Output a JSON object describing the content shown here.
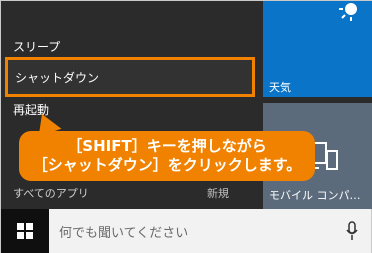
{
  "power_menu": {
    "sleep": "スリープ",
    "shutdown": "シャットダウン",
    "restart": "再起動"
  },
  "start_menu": {
    "all_apps": "すべてのアプリ",
    "new_label": "新規"
  },
  "tiles": {
    "weather": "天気",
    "pc": "モバイル コンパ…"
  },
  "callout": {
    "line1": "［SHIFT］キーを押しながら",
    "line2": "［シャットダウン］をクリックします。"
  },
  "taskbar": {
    "search_placeholder": "何でも聞いてください"
  },
  "colors": {
    "accent": "#f08200",
    "tile_blue": "#0a74c9"
  }
}
